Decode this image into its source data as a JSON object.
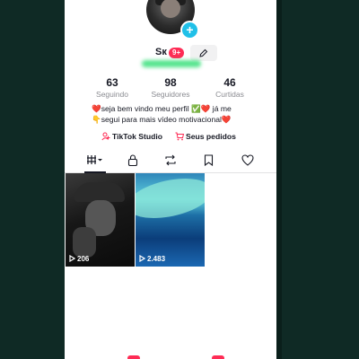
{
  "profile": {
    "username": "Sк",
    "notification_badge": "9+"
  },
  "stats": [
    {
      "value": "63",
      "label": "Seguindo"
    },
    {
      "value": "98",
      "label": "Seguidores"
    },
    {
      "value": "46",
      "label": "Curtidas"
    }
  ],
  "bio": {
    "line1": "❤️seja bem vindo meu perfil ✅❤️ já me",
    "line2": "👇segui para mais vídeo motivacional❤️"
  },
  "links": {
    "studio": "TikTok Studio",
    "orders": "Seus pedidos"
  },
  "videos": [
    {
      "views": "206"
    },
    {
      "views": "2.483"
    }
  ],
  "colors": {
    "accent": "#fe2c55",
    "plus_badge": "#20c0e8",
    "handle_highlight": "#38e07a"
  }
}
